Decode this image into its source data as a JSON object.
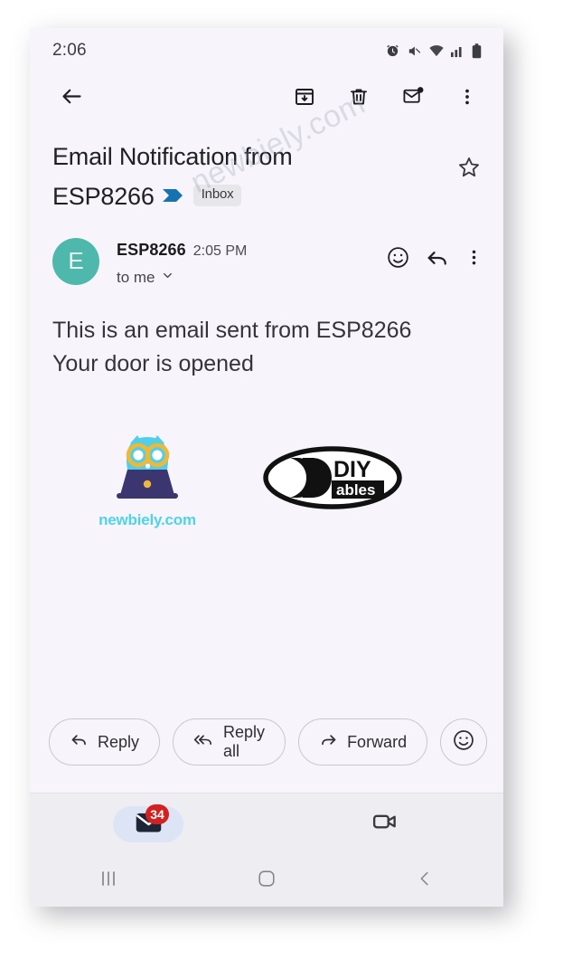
{
  "status_bar": {
    "time": "2:06",
    "icons": [
      "alarm-icon",
      "mute-icon",
      "wifi-icon",
      "signal-icon",
      "battery-icon"
    ]
  },
  "toolbar": {
    "back_icon": "back-arrow-icon",
    "archive_icon": "archive-icon",
    "delete_icon": "trash-icon",
    "mark_unread_icon": "mark-unread-icon",
    "overflow_icon": "more-vertical-icon"
  },
  "email": {
    "subject_line1": "Email Notification from",
    "subject_line2": "ESP8266",
    "label": "Inbox",
    "star_icon": "star-outline-icon",
    "sender_initial": "E",
    "sender_name": "ESP8266",
    "time": "2:05 PM",
    "recipient": "to me",
    "body_line1": "This is an email sent from ESP8266",
    "body_line2": "Your door is opened",
    "emoji_icon": "emoji-smile-icon",
    "reply_icon": "reply-arrow-icon",
    "overflow_icon": "more-vertical-icon"
  },
  "logos": {
    "newbiely_text": "newbiely.com",
    "newbiely_alt": "newbiely-owl-logo",
    "diyables_alt": "diyables-logo",
    "diyables_text_top": "DIY",
    "diyables_text_bottom": "ables"
  },
  "actions": {
    "reply": "Reply",
    "reply_all": "Reply all",
    "forward": "Forward",
    "emoji_icon": "emoji-smile-icon"
  },
  "bottom_nav": {
    "mail_label": "mail-icon",
    "mail_badge": "34",
    "meet_label": "video-camera-icon"
  },
  "android_nav": {
    "recents": "recents-icon",
    "home": "home-icon",
    "back": "back-icon"
  },
  "watermark": {
    "text": "newbiely.com"
  },
  "colors": {
    "avatar_bg": "#4db8ab",
    "accent_blue": "#1473b0",
    "badge_red": "#d32020",
    "newbiely_cyan": "#4fd3ea",
    "nav_pill": "#dde4f6",
    "page_bg": "#f7f5fb"
  }
}
